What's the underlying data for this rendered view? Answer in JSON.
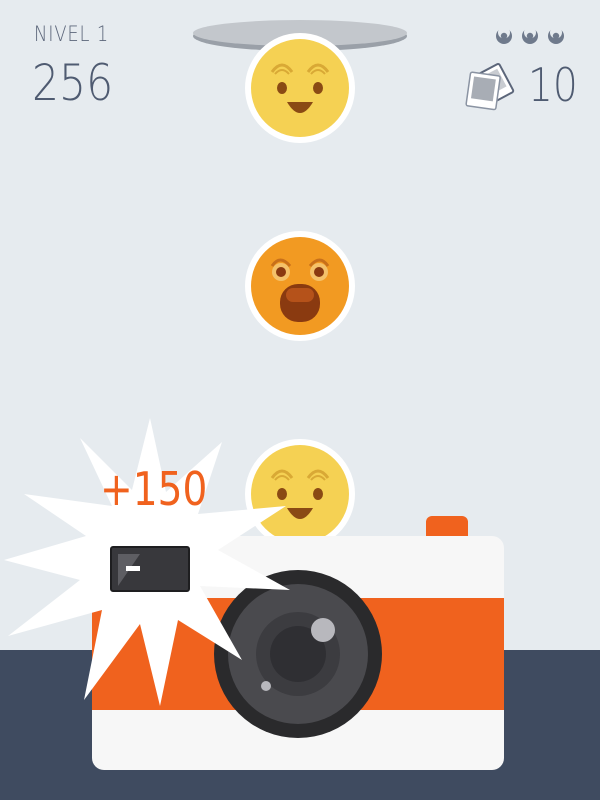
{
  "hud": {
    "level_label": "NIVEL 1",
    "score": "256",
    "photos_remaining": "10",
    "lives_count": 3
  },
  "popup": {
    "points_text": "+150"
  },
  "emojis": [
    {
      "mood": "happy",
      "color": "#f5d153"
    },
    {
      "mood": "shocked",
      "color": "#f29a22"
    },
    {
      "mood": "happy",
      "color": "#f5d153"
    }
  ],
  "colors": {
    "background": "#e6ebef",
    "floor": "#3f4b60",
    "camera_accent": "#f0621e",
    "camera_body": "#f7f7f7",
    "text": "#4f5b71"
  }
}
